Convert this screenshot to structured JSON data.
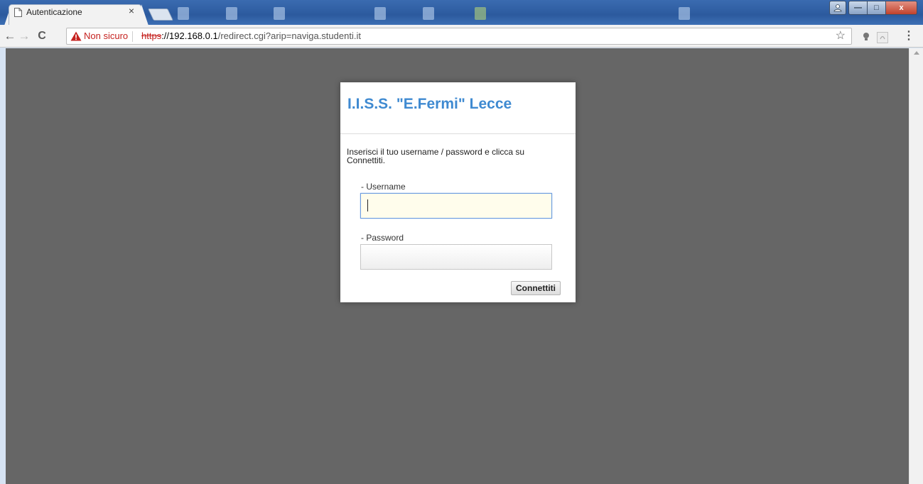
{
  "browser": {
    "tab": {
      "title": "Autenticazione",
      "close_glyph": "×",
      "icon": "page-icon"
    },
    "nav": {
      "back_glyph": "←",
      "forward_glyph": "→",
      "reload_glyph": "C"
    },
    "omnibox": {
      "security_label": "Non sicuro",
      "scheme": "https",
      "url_host": "://192.168.0.1",
      "url_rest": "/redirect.cgi?arip=naviga.studenti.it",
      "warning_color": "#c5221f"
    },
    "toolbar_icons": {
      "star_glyph": "☆",
      "menu_glyph": "⋮"
    },
    "window_controls": {
      "user_glyph": "👤",
      "min_glyph": "—",
      "max_glyph": "□",
      "close_glyph": "x"
    }
  },
  "login": {
    "title": "I.I.S.S. \"E.Fermi\" Lecce",
    "instructions": "Inserisci il tuo username / password e clicca su Connettiti.",
    "username_label": "- Username",
    "username_value": "",
    "password_label": "- Password",
    "password_value": "",
    "submit_label": "Connettiti",
    "title_color": "#3f8ad1"
  }
}
